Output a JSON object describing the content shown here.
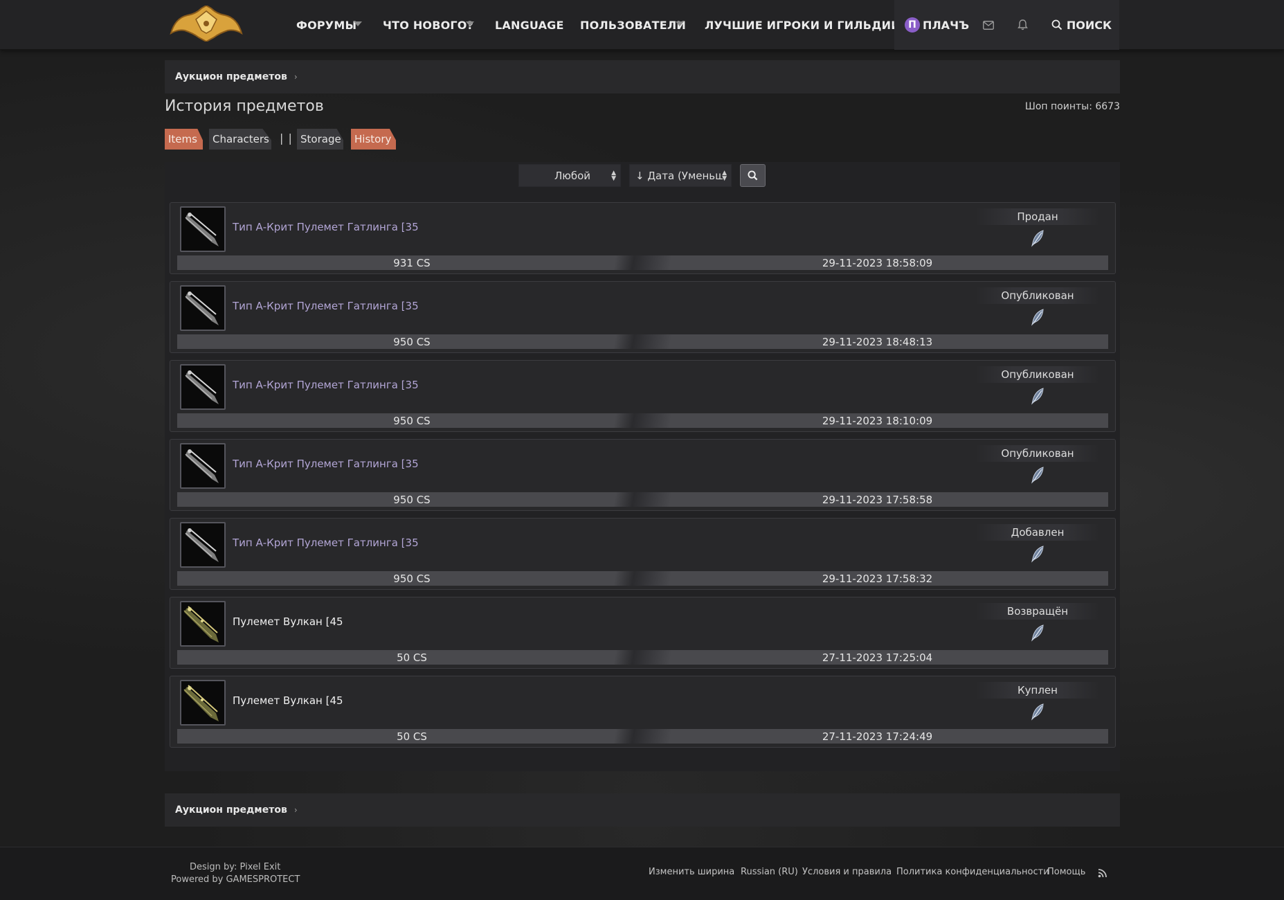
{
  "nav": {
    "forums": "ФОРУМЫ",
    "whats_new": "ЧТО НОВОГО?",
    "language": "LANGUAGE",
    "users": "ПОЛЬЗОВАТЕЛИ",
    "top_players": "ЛУЧШИЕ ИГРОКИ И ГИЛЬДИИ",
    "user_initial": "П",
    "user_name": "ПЛАЧЪ",
    "search": "ПОИСК"
  },
  "breadcrumb": {
    "label": "Аукцион предметов"
  },
  "page": {
    "title": "История предметов",
    "points": "Шоп поинты: 6673"
  },
  "tabs": {
    "items": "Items",
    "characters": "Characters",
    "separator": "| |",
    "storage": "Storage",
    "history": "History"
  },
  "filters": {
    "type_value": "Любой",
    "sort_value": "↓ Дата (Уменьшен"
  },
  "rows": [
    {
      "name": "Тип А-Крит Пулемет Гатлинга [35",
      "status": "Продан",
      "price": "931 CS",
      "date": "29-11-2023 18:58:09"
    },
    {
      "name": "Тип А-Крит Пулемет Гатлинга [35",
      "status": "Опубликован",
      "price": "950 CS",
      "date": "29-11-2023 18:48:13"
    },
    {
      "name": "Тип А-Крит Пулемет Гатлинга [35",
      "status": "Опубликован",
      "price": "950 CS",
      "date": "29-11-2023 18:10:09"
    },
    {
      "name": "Тип А-Крит Пулемет Гатлинга [35",
      "status": "Опубликован",
      "price": "950 CS",
      "date": "29-11-2023 17:58:58"
    },
    {
      "name": "Тип А-Крит Пулемет Гатлинга [35",
      "status": "Добавлен",
      "price": "950 CS",
      "date": "29-11-2023 17:58:32"
    },
    {
      "name": "Пулемет Вулкан [45",
      "status": "Возвращён",
      "price": "50 CS",
      "date": "27-11-2023 17:25:04"
    },
    {
      "name": "Пулемет Вулкан [45",
      "status": "Куплен",
      "price": "50 CS",
      "date": "27-11-2023 17:24:49"
    }
  ],
  "footer": {
    "design_by": "Design by: Pixel Exit",
    "powered_by": "Powered by GAMESPROTECT",
    "change_width": "Изменить ширина",
    "language": "Russian (RU)",
    "terms": "Условия и правила",
    "privacy": "Политика конфиденциальности",
    "help": "Помощь"
  },
  "colors": {
    "accent_tab": "#c56a4f",
    "item_link": "#b3a6d6",
    "avatar": "#8a5ec8"
  }
}
